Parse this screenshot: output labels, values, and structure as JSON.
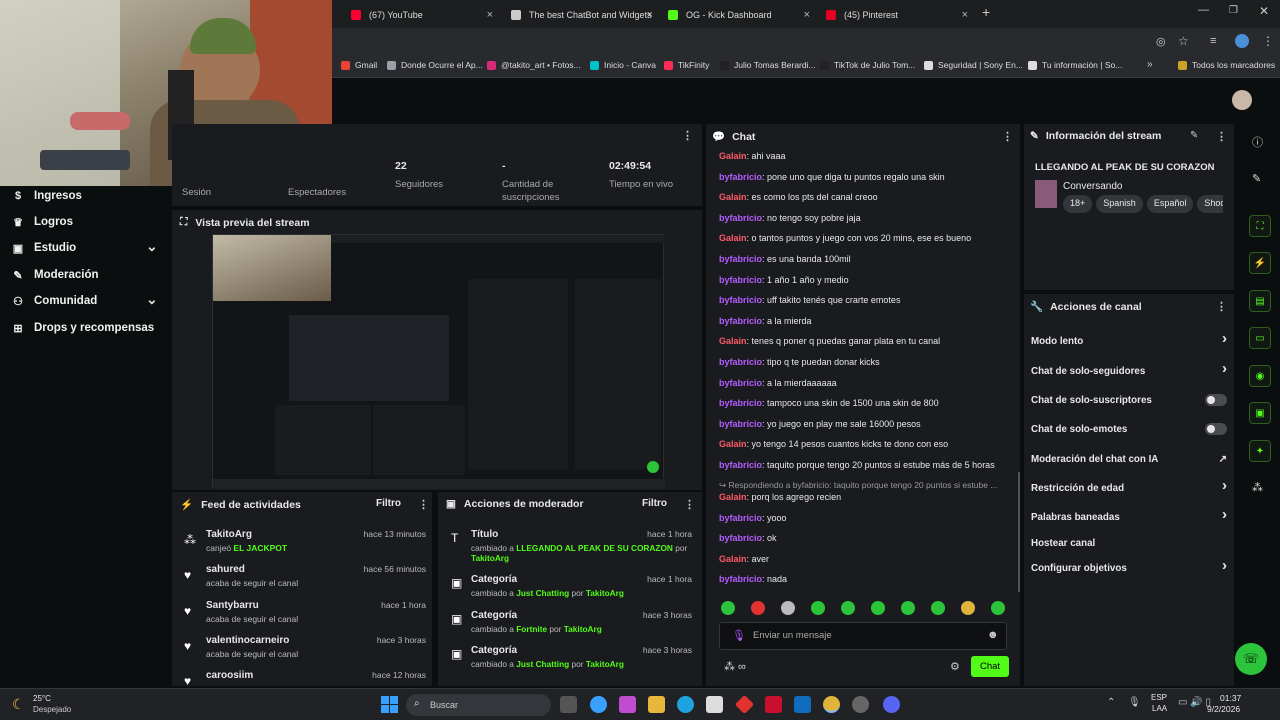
{
  "browser": {
    "tabs": [
      {
        "label": "(67) YouTube",
        "color": "#ff0033"
      },
      {
        "label": "The best ChatBot and Widgets",
        "color": "#cccccc"
      },
      {
        "label": "OG - Kick Dashboard",
        "color": "#53fc18"
      },
      {
        "label": "(45) Pinterest",
        "color": "#e60023"
      }
    ],
    "bookmarks": [
      {
        "label": "Gmail",
        "color": "#ea4335"
      },
      {
        "label": "Donde Ocurre el Ap...",
        "color": "#9aa0a6"
      },
      {
        "label": "@takito_art • Fotos...",
        "color": "#d62976"
      },
      {
        "label": "Inicio - Canva",
        "color": "#00c4cc"
      },
      {
        "label": "TikFinity",
        "color": "#ff2d55"
      },
      {
        "label": "Julio Tomas Berardi...",
        "color": "#222222"
      },
      {
        "label": "TikTok de Julio Tom...",
        "color": "#222222"
      },
      {
        "label": "Seguridad | Sony En...",
        "color": "#dddddd"
      },
      {
        "label": "Tu información | So...",
        "color": "#dddddd"
      }
    ],
    "all_bookmarks": "Todos los marcadores"
  },
  "nav": {
    "items": [
      {
        "label": "Ingresos",
        "icon": "coin-icon"
      },
      {
        "label": "Logros",
        "icon": "trophy-icon"
      },
      {
        "label": "Estudio",
        "icon": "studio-icon"
      },
      {
        "label": "Moderación",
        "icon": "wrench-icon"
      },
      {
        "label": "Comunidad",
        "icon": "community-icon"
      },
      {
        "label": "Drops y recompensas",
        "icon": "gift-icon"
      }
    ]
  },
  "stats": {
    "sesion": "Sesión",
    "espectadores": "Espectadores",
    "seguidores_value": "22",
    "seguidores": "Seguidores",
    "suscripciones_value": "-",
    "suscripciones": "Cantidad de suscripciones",
    "tiempo_value": "02:49:54",
    "tiempo": "Tiempo en vivo"
  },
  "preview": {
    "title": "Vista previa del stream"
  },
  "feed": {
    "title": "Feed de actividades",
    "filter": "Filtro",
    "items": [
      {
        "name": "TakitoArg",
        "prefix": "canjeó ",
        "highlight": "EL JACKPOT",
        "time": "hace 13 minutos"
      },
      {
        "name": "sahured",
        "sub": "acaba de seguir el canal",
        "time": "hace 56 minutos"
      },
      {
        "name": "Santybarru",
        "sub": "acaba de seguir el canal",
        "time": "hace 1 hora"
      },
      {
        "name": "valentinocarneiro",
        "sub": "acaba de seguir el canal",
        "time": "hace 3 horas"
      },
      {
        "name": "caroosiim",
        "time": "hace 12 horas"
      }
    ]
  },
  "modactions": {
    "title": "Acciones de moderador",
    "filter": "Filtro",
    "items": [
      {
        "name": "Título",
        "time": "hace 1 hora",
        "pre": "cambiado a ",
        "value": "LLEGANDO AL PEAK DE SU CORAZON",
        "por": " por ",
        "user": "TakitoArg"
      },
      {
        "name": "Categoría",
        "time": "hace 1 hora",
        "pre": "cambiado a ",
        "value": "Just Chatting",
        "por": " por ",
        "user": "TakitoArg"
      },
      {
        "name": "Categoría",
        "time": "hace 3 horas",
        "pre": "cambiado a ",
        "value": "Fortnite",
        "por": " por ",
        "user": "TakitoArg"
      },
      {
        "name": "Categoría",
        "time": "hace 3 horas",
        "pre": "cambiado a ",
        "value": "Just Chatting",
        "por": " por ",
        "user": "TakitoArg"
      }
    ]
  },
  "chat": {
    "title": "Chat",
    "messages": [
      {
        "user": "Galain",
        "text": "ahi vaaa",
        "c": "u2"
      },
      {
        "user": "byfabricio",
        "text": "pone uno que diga tu puntos regalo una skin",
        "c": "u1"
      },
      {
        "user": "Galain",
        "text": "es como los pts del canal creoo",
        "c": "u2"
      },
      {
        "user": "byfabricio",
        "text": "no tengo soy pobre jaja",
        "c": "u1"
      },
      {
        "user": "Galain",
        "text": "o tantos puntos y juego con vos 20 mins, ese es bueno",
        "c": "u2"
      },
      {
        "user": "byfabricio",
        "text": "es una banda 100mil",
        "c": "u1"
      },
      {
        "user": "byfabricio",
        "text": "1 año 1 año y medio",
        "c": "u1"
      },
      {
        "user": "byfabricio",
        "text": "uff takito tenés que crarte emotes",
        "c": "u1"
      },
      {
        "user": "byfabricio",
        "text": "a la mierda",
        "c": "u1"
      },
      {
        "user": "Galain",
        "text": "tenes q poner q puedas ganar plata en tu canal",
        "c": "u2"
      },
      {
        "user": "byfabricio",
        "text": "tipo q te puedan donar kicks",
        "c": "u1"
      },
      {
        "user": "byfabricio",
        "text": "a la mierdaaaaaa",
        "c": "u1"
      },
      {
        "user": "byfabricio",
        "text": "tampoco una skin de 1500 una skin de 800",
        "c": "u1"
      },
      {
        "user": "byfabricio",
        "text": "yo juego en play me sale 16000 pesos",
        "c": "u1"
      },
      {
        "user": "Galain",
        "text": "yo tengo 14 pesos cuantos kicks te dono con eso",
        "c": "u2"
      },
      {
        "user": "byfabricio",
        "text": "taquito porque tengo 20 puntos si estube más de 5 horas",
        "c": "u1"
      }
    ],
    "reply_note": "Respondiendo a byfabricio: taquito porque tengo 20 puntos si estube ...",
    "messages2": [
      {
        "user": "Galain",
        "text": "porq los agrego recien",
        "c": "u2"
      },
      {
        "user": "byfabricio",
        "text": "yooo",
        "c": "u1"
      },
      {
        "user": "byfabricio",
        "text": "ok",
        "c": "u1"
      },
      {
        "user": "Galain",
        "text": "aver",
        "c": "u2"
      },
      {
        "user": "byfabricio",
        "text": "nada",
        "c": "u1"
      }
    ],
    "input_placeholder": "Enviar un mensaje",
    "send": "Chat"
  },
  "streaminfo": {
    "title": "Información del stream",
    "stream_title": "LLEGANDO AL PEAK DE SU CORAZON",
    "category": "Conversando",
    "tags": [
      "18+",
      "Spanish",
      "Español",
      "Shoo"
    ]
  },
  "channel_actions": {
    "title": "Acciones de canal",
    "items": [
      {
        "label": "Modo lento",
        "kind": "chevron"
      },
      {
        "label": "Chat de solo-seguidores",
        "kind": "chevron"
      },
      {
        "label": "Chat de solo-suscriptores",
        "kind": "toggle"
      },
      {
        "label": "Chat de solo-emotes",
        "kind": "toggle"
      },
      {
        "label": "Moderación del chat con IA",
        "kind": "external"
      },
      {
        "label": "Restricción de edad",
        "kind": "chevron"
      },
      {
        "label": "Palabras baneadas",
        "kind": "chevron"
      },
      {
        "label": "Hostear canal",
        "kind": "none"
      },
      {
        "label": "Configurar objetivos",
        "kind": "chevron"
      }
    ]
  },
  "taskbar": {
    "temp": "25°C",
    "weather": "Despejado",
    "search": "Buscar",
    "lang1": "ESP",
    "lang2": "LAA",
    "time": "01:37",
    "date": "9/2/2026"
  }
}
